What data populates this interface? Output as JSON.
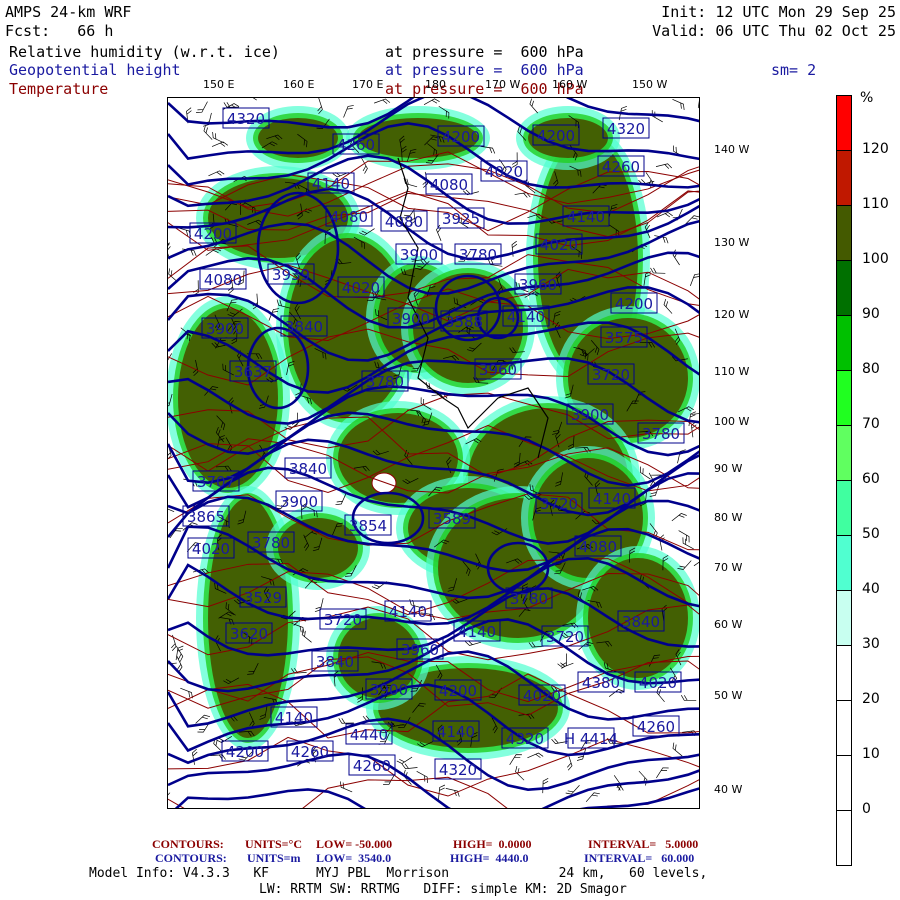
{
  "header": {
    "model": "AMPS 24-km WRF",
    "fcst": "Fcst:   66 h",
    "init": "Init: 12 UTC Mon 29 Sep 25",
    "valid": "Valid: 06 UTC Thu 02 Oct 25",
    "fields": [
      {
        "name": "Relative humidity (w.r.t. ice)",
        "level": "at pressure =  600 hPa",
        "color": "#000000"
      },
      {
        "name": "Geopotential height",
        "level": "at pressure =  600 hPa",
        "color": "#1a1aa0"
      },
      {
        "name": "Temperature",
        "level": "at pressure =  600 hPa",
        "color": "#8b0000"
      }
    ],
    "smoothing": "sm= 2"
  },
  "map": {
    "lon_labels": [
      "150 E",
      "160 E",
      "170 E",
      "180",
      "170 W",
      "160 W",
      "150 W"
    ],
    "lat_labels": [
      "140 W",
      "130 W",
      "120 W",
      "110 W",
      "100 W",
      "90 W",
      "80 W",
      "70 W",
      "60 W",
      "50 W",
      "40 W"
    ],
    "height_labels": [
      "4320",
      "4260",
      "4200",
      "4200",
      "4320",
      "4260",
      "4020",
      "4140",
      "4080",
      "4080",
      "4080",
      "3925",
      "4200",
      "4140",
      "4020",
      "3939",
      "4080",
      "3900",
      "3780",
      "4020",
      "3960",
      "4200",
      "3588",
      "3900",
      "3840",
      "3900",
      "4140",
      "3575",
      "3637",
      "3780",
      "3960",
      "3720",
      "3900",
      "3780",
      "3707",
      "3840",
      "3900",
      "3865",
      "3854",
      "3589",
      "3720",
      "4140",
      "4020",
      "3780",
      "4080",
      "3529",
      "3720",
      "4140",
      "3620",
      "3780",
      "4140",
      "3840",
      "3720",
      "3840",
      "3960",
      "3900",
      "4200",
      "4380",
      "4020",
      "4020",
      "4140",
      "4440",
      "4140",
      "4320",
      "H 4414",
      "4260",
      "4200",
      "4260",
      "4260",
      "4320"
    ]
  },
  "colorbar": {
    "unit": "%",
    "ticks": [
      "120",
      "110",
      "100",
      "90",
      "80",
      "70",
      "60",
      "50",
      "40",
      "30",
      "20",
      "10",
      "0"
    ],
    "colors": [
      "#ff0000",
      "#c01800",
      "#445a00",
      "#007000",
      "#00c000",
      "#20ff20",
      "#60ff60",
      "#40ffa0",
      "#50ffd0",
      "#c8fff0",
      "#ffffff",
      "#ffffff",
      "#ffffff",
      "#ffffff"
    ]
  },
  "footer": {
    "temp_contours": {
      "label": "CONTOURS:",
      "units": "UNITS=°C",
      "low": "LOW= -50.000",
      "high": "HIGH=  0.0000",
      "interval": "INTERVAL=   5.0000",
      "color": "#8b0000"
    },
    "height_contours": {
      "label": "CONTOURS:",
      "units": "UNITS=m",
      "low": "LOW=  3540.0",
      "high": "HIGH=  4440.0",
      "interval": "INTERVAL=   60.000",
      "color": "#1a1aa0"
    },
    "model_info": "Model Info: V4.3.3   KF      MYJ PBL  Morrison              24 km,   60 levels,",
    "model_info2": "LW: RRTM SW: RRTMG   DIFF: simple KM: 2D Smagor"
  }
}
